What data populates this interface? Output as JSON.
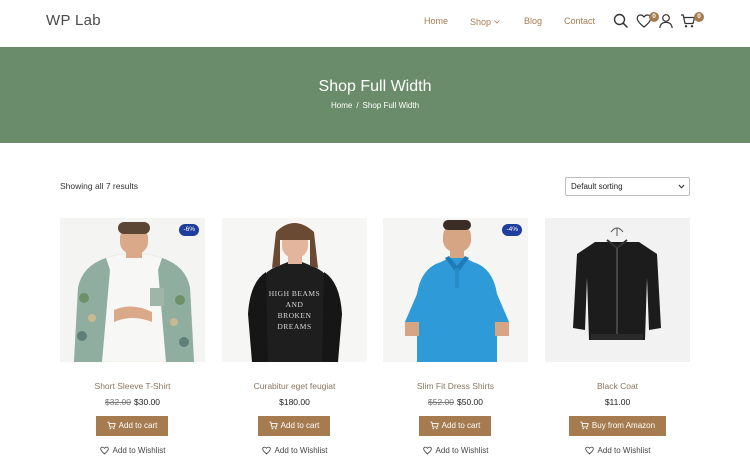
{
  "header": {
    "logo": "WP Lab",
    "nav": [
      "Home",
      "Shop",
      "Blog",
      "Contact"
    ],
    "wishlist_count": "0",
    "cart_count": "0"
  },
  "hero": {
    "title": "Shop Full Width",
    "breadcrumb": [
      "Home",
      "/",
      "Shop Full Width"
    ]
  },
  "toolbar": {
    "result_count": "Showing all 7 results",
    "sort_selected": "Default sorting"
  },
  "products": [
    {
      "title": "Short Sleeve T-Shirt",
      "old_price": "$32.00",
      "price": "$30.00",
      "badge": "-6%",
      "button": "Add to cart",
      "wishlist": "Add to Wishlist"
    },
    {
      "title": "Curabitur eget feugiat",
      "old_price": "",
      "price": "$180.00",
      "badge": "",
      "button": "Add to cart",
      "wishlist": "Add to Wishlist"
    },
    {
      "title": "Slim Fit Dress Shirts",
      "old_price": "$52.00",
      "price": "$50.00",
      "badge": "-4%",
      "button": "Add to cart",
      "wishlist": "Add to Wishlist"
    },
    {
      "title": "Black Coat",
      "old_price": "",
      "price": "$11.00",
      "badge": "",
      "button": "Buy from Amazon",
      "wishlist": "Add to Wishlist"
    }
  ],
  "sweater_print": [
    "HIGH BEAMS",
    "AND",
    "BROKEN",
    "DREAMS"
  ],
  "colors": {
    "accent": "#a57b4f",
    "hero_bg": "#6b8c6b",
    "badge": "#1f3d9c"
  },
  "icons": [
    "search-icon",
    "heart-icon",
    "user-icon",
    "cart-icon",
    "chevron-down-icon"
  ]
}
